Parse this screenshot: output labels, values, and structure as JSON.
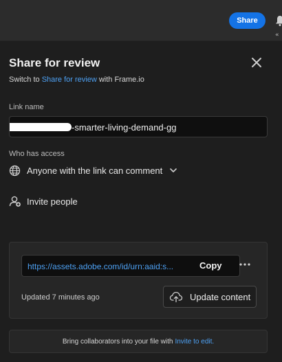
{
  "topbar": {
    "share_label": "Share",
    "chevrons": "«"
  },
  "dialog": {
    "title": "Share for review",
    "switch_prefix": "Switch to ",
    "switch_link": "Share for review",
    "switch_suffix": " with Frame.io",
    "link_name_label": "Link name",
    "link_name_value": "-smarter-living-demand-gg",
    "who_has_access_label": "Who has access",
    "access_option": "Anyone with the link can comment",
    "invite_label": "Invite people"
  },
  "link_card": {
    "url": "https://assets.adobe.com/id/urn:aaid:s...",
    "copy_label": "Copy",
    "updated_text": "Updated 7 minutes ago",
    "update_button_label": "Update content"
  },
  "footer": {
    "prefix": "Bring collaborators into your file with ",
    "link": "Invite to edit."
  },
  "colors": {
    "accent": "#1473e6",
    "link": "#4ea2f5",
    "background": "#1e1e1e"
  }
}
